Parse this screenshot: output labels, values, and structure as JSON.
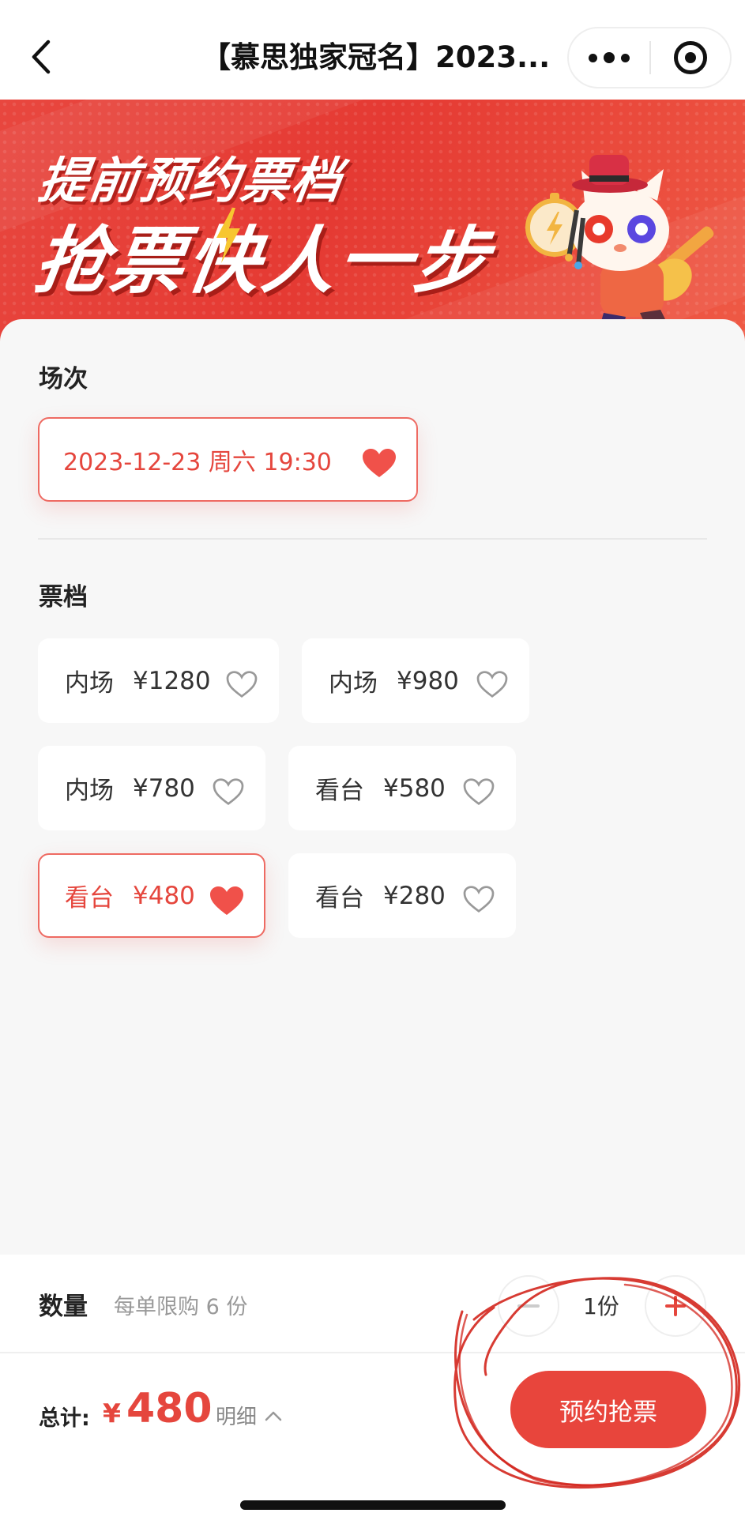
{
  "navbar": {
    "title": "【慕思独家冠名】2023..."
  },
  "banner": {
    "line1": "提前预约票档",
    "line2": "抢票快人一步"
  },
  "session": {
    "label": "场次",
    "selected": "2023-12-23 周六 19:30"
  },
  "tiers": {
    "label": "票档",
    "items": [
      {
        "name": "内场",
        "price": "¥1280",
        "selected": false
      },
      {
        "name": "内场",
        "price": "¥980",
        "selected": false
      },
      {
        "name": "内场",
        "price": "¥780",
        "selected": false
      },
      {
        "name": "看台",
        "price": "¥580",
        "selected": false
      },
      {
        "name": "看台",
        "price": "¥480",
        "selected": true
      },
      {
        "name": "看台",
        "price": "¥280",
        "selected": false
      }
    ]
  },
  "quantity": {
    "label": "数量",
    "limit": "每单限购 6 份",
    "value": "1份"
  },
  "footer": {
    "total_label": "总计:",
    "currency": "¥",
    "amount": "480",
    "detail": "明细",
    "reserve_button": "预约抢票"
  },
  "colors": {
    "accent": "#e8453c",
    "banner": "#e53a33"
  },
  "icons": [
    "back-arrow-icon",
    "more-dots-icon",
    "target-icon",
    "heart-icon",
    "chevron-up-icon",
    "plus-icon",
    "minus-icon"
  ]
}
